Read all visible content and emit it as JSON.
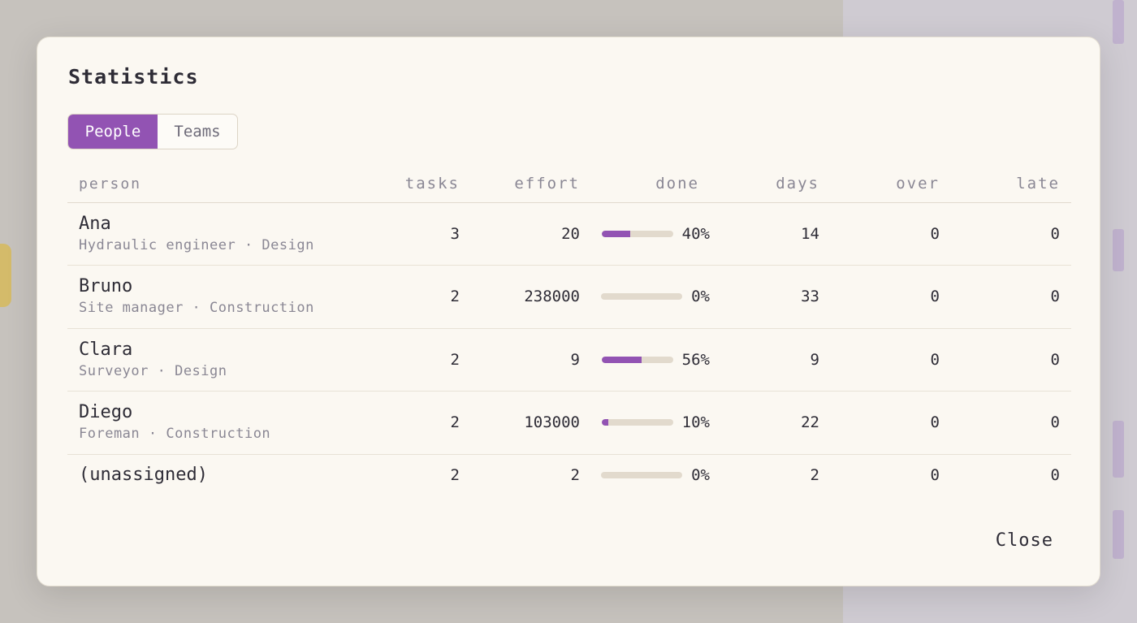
{
  "dialog": {
    "title": "Statistics",
    "tabs": [
      {
        "label": "People",
        "active": true
      },
      {
        "label": "Teams",
        "active": false
      }
    ],
    "close_label": "Close"
  },
  "table": {
    "headers": {
      "person": "person",
      "tasks": "tasks",
      "effort": "effort",
      "done": "done",
      "days": "days",
      "over": "over",
      "late": "late"
    },
    "rows": [
      {
        "name": "Ana",
        "role": "Hydraulic engineer · Design",
        "tasks": "3",
        "effort": "20",
        "done_pct": 40,
        "done": "40%",
        "days": "14",
        "over": "0",
        "late": "0"
      },
      {
        "name": "Bruno",
        "role": "Site manager · Construction",
        "tasks": "2",
        "effort": "238000",
        "done_pct": 0,
        "done": "0%",
        "days": "33",
        "over": "0",
        "late": "0"
      },
      {
        "name": "Clara",
        "role": "Surveyor · Design",
        "tasks": "2",
        "effort": "9",
        "done_pct": 56,
        "done": "56%",
        "days": "9",
        "over": "0",
        "late": "0"
      },
      {
        "name": "Diego",
        "role": "Foreman · Construction",
        "tasks": "2",
        "effort": "103000",
        "done_pct": 10,
        "done": "10%",
        "days": "22",
        "over": "0",
        "late": "0"
      },
      {
        "name": "(unassigned)",
        "role": "",
        "tasks": "2",
        "effort": "2",
        "done_pct": 0,
        "done": "0%",
        "days": "2",
        "over": "0",
        "late": "0"
      }
    ]
  },
  "colors": {
    "accent": "#9253b3",
    "track": "#e2dacd",
    "modal_bg": "#fbf8f2"
  }
}
